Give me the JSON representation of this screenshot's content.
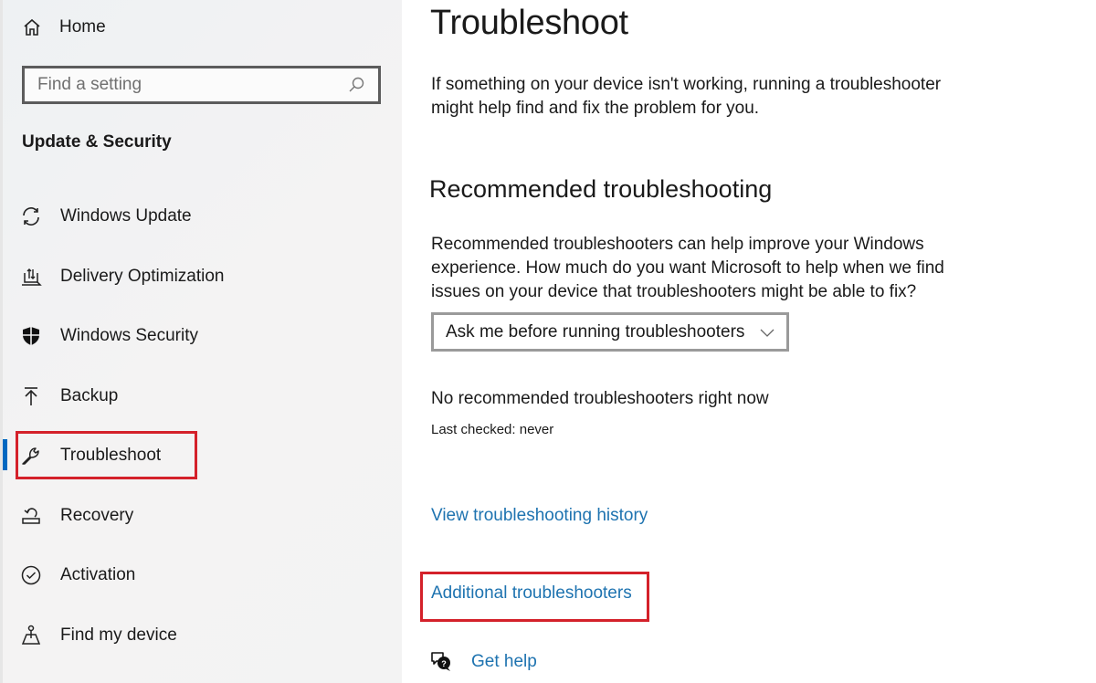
{
  "sidebar": {
    "home_label": "Home",
    "search_placeholder": "Find a setting",
    "section_title": "Update & Security",
    "items": [
      {
        "label": "Windows Update",
        "icon": "sync-icon"
      },
      {
        "label": "Delivery Optimization",
        "icon": "delivery-optimization-icon"
      },
      {
        "label": "Windows Security",
        "icon": "shield-icon"
      },
      {
        "label": "Backup",
        "icon": "upload-arrow-icon"
      },
      {
        "label": "Troubleshoot",
        "icon": "wrench-icon",
        "selected": true
      },
      {
        "label": "Recovery",
        "icon": "recovery-icon"
      },
      {
        "label": "Activation",
        "icon": "check-circle-icon"
      },
      {
        "label": "Find my device",
        "icon": "find-device-icon"
      }
    ]
  },
  "main": {
    "title": "Troubleshoot",
    "intro": "If something on your device isn't working, running a troubleshooter might help find and fix the problem for you.",
    "recommended_heading": "Recommended troubleshooting",
    "recommended_desc": "Recommended troubleshooters can help improve your Windows experience. How much do you want Microsoft to help when we find issues on your device that troubleshooters might be able to fix?",
    "dropdown_value": "Ask me before running troubleshooters",
    "status": "No recommended troubleshooters right now",
    "last_checked": "Last checked: never",
    "history_link": "View troubleshooting history",
    "additional_link": "Additional troubleshooters",
    "help_link": "Get help"
  },
  "colors": {
    "accent": "#0067c0",
    "link": "#1e73b0",
    "highlight": "#d4212a"
  }
}
